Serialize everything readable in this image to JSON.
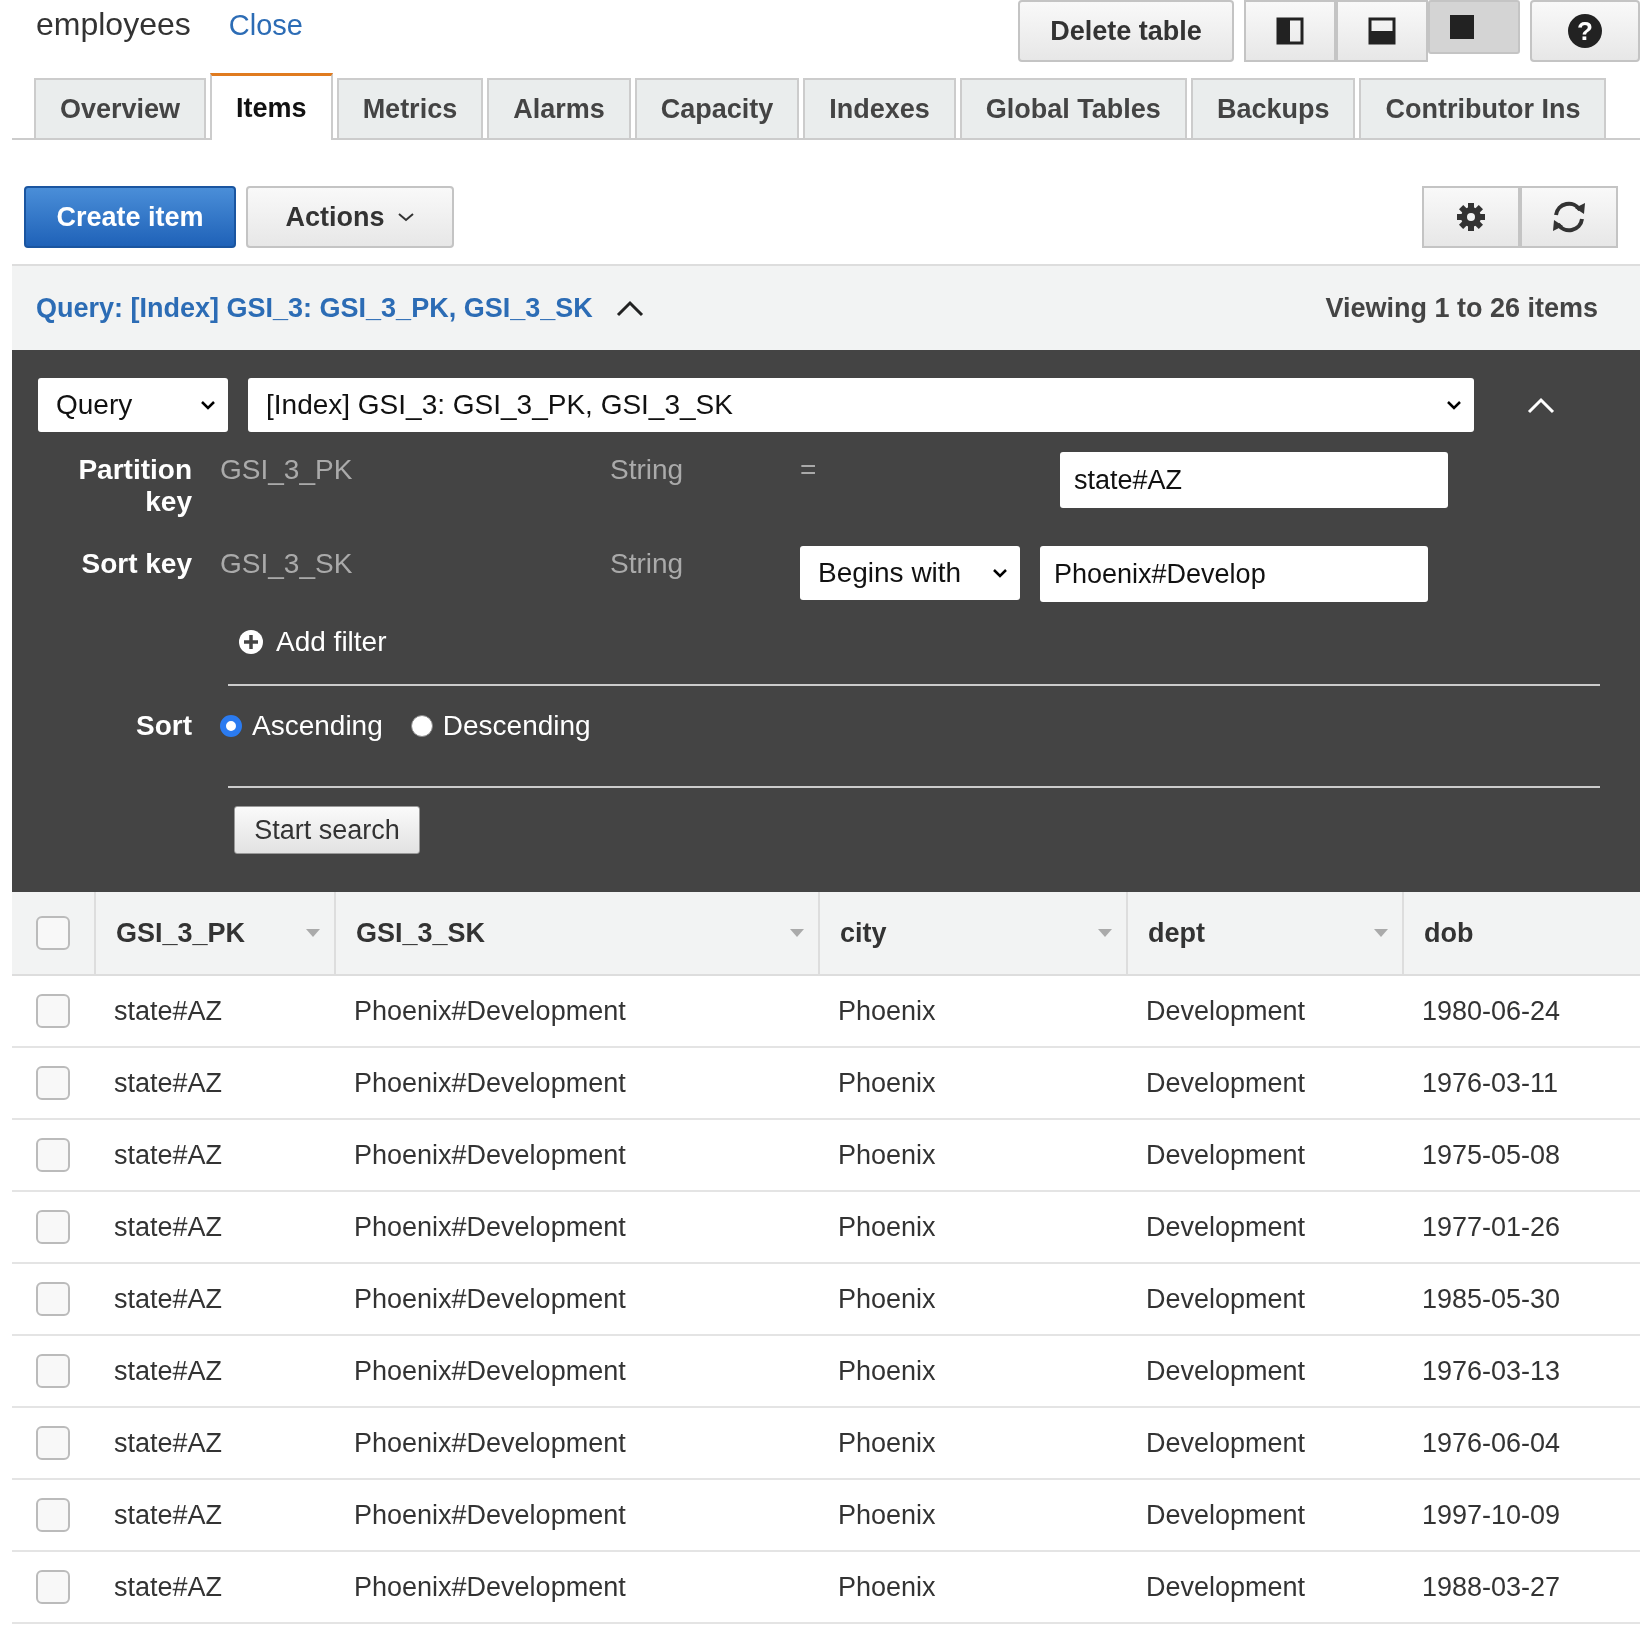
{
  "header": {
    "title": "employees",
    "close_link": "Close",
    "delete_button": "Delete table",
    "layout_buttons": [
      {
        "kind": "split-vertical",
        "selected": false
      },
      {
        "kind": "split-horizontal",
        "selected": false
      },
      {
        "kind": "full",
        "selected": true
      }
    ],
    "help_button": "?"
  },
  "tabs": [
    {
      "label": "Overview",
      "selected": false
    },
    {
      "label": "Items",
      "selected": true
    },
    {
      "label": "Metrics",
      "selected": false
    },
    {
      "label": "Alarms",
      "selected": false
    },
    {
      "label": "Capacity",
      "selected": false
    },
    {
      "label": "Indexes",
      "selected": false
    },
    {
      "label": "Global Tables",
      "selected": false
    },
    {
      "label": "Backups",
      "selected": false
    },
    {
      "label": "Contributor Ins",
      "selected": false
    }
  ],
  "toolbar": {
    "create_button": "Create item",
    "actions_button": "Actions"
  },
  "query_bar": {
    "title": "Query: [Index] GSI_3: GSI_3_PK, GSI_3_SK",
    "expanded": true,
    "viewing": "Viewing 1 to 26 items"
  },
  "query_form": {
    "mode": "Query",
    "index": "[Index] GSI_3: GSI_3_PK, GSI_3_SK",
    "partition_key": {
      "label": "Partition key",
      "attribute": "GSI_3_PK",
      "type": "String",
      "operator": "=",
      "value": "state#AZ"
    },
    "sort_key": {
      "label": "Sort key",
      "attribute": "GSI_3_SK",
      "type": "String",
      "condition": "Begins with",
      "value": "Phoenix#Develop"
    },
    "add_filter": "Add filter",
    "sort": {
      "label": "Sort",
      "options": [
        {
          "label": "Ascending",
          "selected": true
        },
        {
          "label": "Descending",
          "selected": false
        }
      ]
    },
    "start_button": "Start search"
  },
  "table": {
    "columns": [
      {
        "label": "GSI_3_PK",
        "sort_caret": true
      },
      {
        "label": "GSI_3_SK",
        "sort_caret": true
      },
      {
        "label": "city",
        "sort_caret": true
      },
      {
        "label": "dept",
        "sort_caret": true
      },
      {
        "label": "dob",
        "sort_caret": false
      }
    ],
    "header_checked": false,
    "rows": [
      {
        "checked": false,
        "cells": [
          "state#AZ",
          "Phoenix#Development",
          "Phoenix",
          "Development",
          "1980-06-24"
        ]
      },
      {
        "checked": false,
        "cells": [
          "state#AZ",
          "Phoenix#Development",
          "Phoenix",
          "Development",
          "1976-03-11"
        ]
      },
      {
        "checked": false,
        "cells": [
          "state#AZ",
          "Phoenix#Development",
          "Phoenix",
          "Development",
          "1975-05-08"
        ]
      },
      {
        "checked": false,
        "cells": [
          "state#AZ",
          "Phoenix#Development",
          "Phoenix",
          "Development",
          "1977-01-26"
        ]
      },
      {
        "checked": false,
        "cells": [
          "state#AZ",
          "Phoenix#Development",
          "Phoenix",
          "Development",
          "1985-05-30"
        ]
      },
      {
        "checked": false,
        "cells": [
          "state#AZ",
          "Phoenix#Development",
          "Phoenix",
          "Development",
          "1976-03-13"
        ]
      },
      {
        "checked": false,
        "cells": [
          "state#AZ",
          "Phoenix#Development",
          "Phoenix",
          "Development",
          "1976-06-04"
        ]
      },
      {
        "checked": false,
        "cells": [
          "state#AZ",
          "Phoenix#Development",
          "Phoenix",
          "Development",
          "1997-10-09"
        ]
      },
      {
        "checked": false,
        "cells": [
          "state#AZ",
          "Phoenix#Development",
          "Phoenix",
          "Development",
          "1988-03-27"
        ]
      }
    ]
  }
}
